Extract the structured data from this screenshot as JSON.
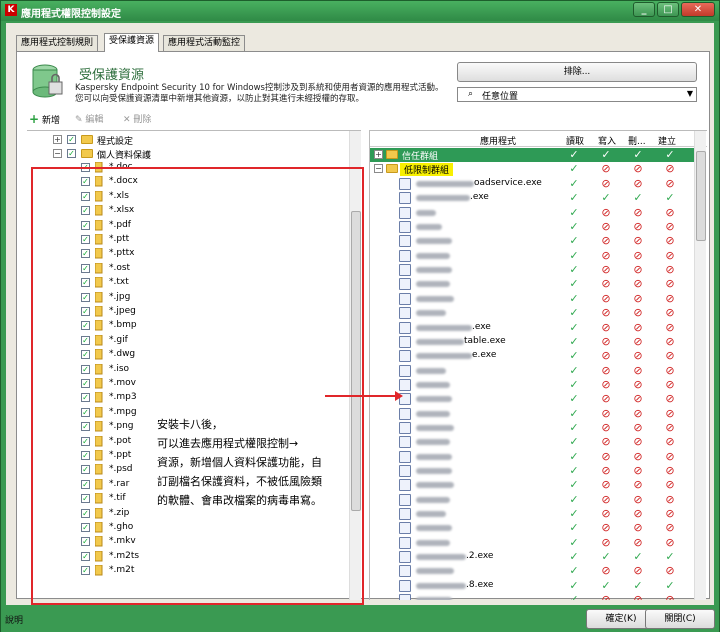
{
  "window": {
    "title": "應用程式權限控制設定",
    "min": "_",
    "max": "□",
    "close": "✕"
  },
  "tabs": [
    "應用程式控制規則",
    "受保護資源",
    "應用程式活動監控"
  ],
  "header": {
    "title": "受保護資源",
    "description": "Kaspersky Endpoint Security 10 for Windows控制涉及到系統和使用者資源的應用程式活動。您可以向受保護資源清單中新增其他資源，以防止對其進行未經授權的存取。",
    "exclude_label": "排除...",
    "location_label": "任意位置"
  },
  "toolbar": {
    "add": "新增",
    "edit": "編輯",
    "delete": "刪除"
  },
  "tree": {
    "app_settings": "程式設定",
    "personal_data": "個人資料保護",
    "extensions": [
      "*.doc",
      "*.docx",
      "*.xls",
      "*.xlsx",
      "*.pdf",
      "*.ptt",
      "*.pttx",
      "*.ost",
      "*.txt",
      "*.jpg",
      "*.jpeg",
      "*.bmp",
      "*.gif",
      "*.dwg",
      "*.iso",
      "*.mov",
      "*.mp3",
      "*.mpg",
      "*.png",
      "*.pot",
      "*.ppt",
      "*.psd",
      "*.rar",
      "*.tif",
      "*.zip",
      "*.gho",
      "*.mkv",
      "*.m2ts",
      "*.m2t"
    ]
  },
  "callout": [
    "安裝卡八後，",
    "可以進去應用程式權限控制→",
    "資源，新增個人資料保護功能，自",
    "訂副檔名保護資料，不被低風險類",
    "的軟體、會串改檔案的病毒串寫。"
  ],
  "right": {
    "columns": {
      "app": "應用程式",
      "read": "讀取",
      "write": "寫入",
      "delete": "刪...",
      "create": "建立"
    },
    "trusted_group": "信任群組",
    "low_group": "低限制群組",
    "apps": [
      {
        "name": "oadservice.exe",
        "blur": 58,
        "r": "ok",
        "w": "no",
        "d": "no",
        "c": "no"
      },
      {
        "name": ".exe",
        "blur": 54,
        "r": "ok",
        "w": "ok",
        "d": "ok",
        "c": "ok"
      },
      {
        "name": "",
        "blur": 20,
        "r": "ok",
        "w": "no",
        "d": "no",
        "c": "no"
      },
      {
        "name": "",
        "blur": 26,
        "r": "ok",
        "w": "no",
        "d": "no",
        "c": "no"
      },
      {
        "name": "",
        "blur": 36,
        "r": "ok",
        "w": "no",
        "d": "no",
        "c": "no"
      },
      {
        "name": "",
        "blur": 34,
        "r": "ok",
        "w": "no",
        "d": "no",
        "c": "no"
      },
      {
        "name": "",
        "blur": 36,
        "r": "ok",
        "w": "no",
        "d": "no",
        "c": "no"
      },
      {
        "name": "",
        "blur": 34,
        "r": "ok",
        "w": "no",
        "d": "no",
        "c": "no"
      },
      {
        "name": "",
        "blur": 38,
        "r": "ok",
        "w": "no",
        "d": "no",
        "c": "no"
      },
      {
        "name": "",
        "blur": 30,
        "r": "ok",
        "w": "no",
        "d": "no",
        "c": "no"
      },
      {
        "name": ".exe",
        "blur": 56,
        "r": "ok",
        "w": "no",
        "d": "no",
        "c": "no"
      },
      {
        "name": "table.exe",
        "blur": 48,
        "r": "ok",
        "w": "no",
        "d": "no",
        "c": "no"
      },
      {
        "name": "e.exe",
        "blur": 56,
        "r": "ok",
        "w": "no",
        "d": "no",
        "c": "no"
      },
      {
        "name": "",
        "blur": 30,
        "r": "ok",
        "w": "no",
        "d": "no",
        "c": "no"
      },
      {
        "name": "",
        "blur": 34,
        "r": "ok",
        "w": "no",
        "d": "no",
        "c": "no"
      },
      {
        "name": "",
        "blur": 36,
        "r": "ok",
        "w": "no",
        "d": "no",
        "c": "no"
      },
      {
        "name": "",
        "blur": 34,
        "r": "ok",
        "w": "no",
        "d": "no",
        "c": "no"
      },
      {
        "name": "",
        "blur": 38,
        "r": "ok",
        "w": "no",
        "d": "no",
        "c": "no"
      },
      {
        "name": "",
        "blur": 34,
        "r": "ok",
        "w": "no",
        "d": "no",
        "c": "no"
      },
      {
        "name": "",
        "blur": 36,
        "r": "ok",
        "w": "no",
        "d": "no",
        "c": "no"
      },
      {
        "name": "",
        "blur": 36,
        "r": "ok",
        "w": "no",
        "d": "no",
        "c": "no"
      },
      {
        "name": "",
        "blur": 38,
        "r": "ok",
        "w": "no",
        "d": "no",
        "c": "no"
      },
      {
        "name": "",
        "blur": 34,
        "r": "ok",
        "w": "no",
        "d": "no",
        "c": "no"
      },
      {
        "name": "",
        "blur": 30,
        "r": "ok",
        "w": "no",
        "d": "no",
        "c": "no"
      },
      {
        "name": "",
        "blur": 36,
        "r": "ok",
        "w": "no",
        "d": "no",
        "c": "no"
      },
      {
        "name": "",
        "blur": 34,
        "r": "ok",
        "w": "no",
        "d": "no",
        "c": "no"
      },
      {
        "name": ".2.exe",
        "blur": 50,
        "r": "ok",
        "w": "ok",
        "d": "ok",
        "c": "ok"
      },
      {
        "name": "",
        "blur": 38,
        "r": "ok",
        "w": "no",
        "d": "no",
        "c": "no"
      },
      {
        "name": ".8.exe",
        "blur": 50,
        "r": "ok",
        "w": "ok",
        "d": "ok",
        "c": "ok"
      },
      {
        "name": "",
        "blur": 36,
        "r": "ok",
        "w": "no",
        "d": "no",
        "c": "no"
      },
      {
        "name": "",
        "blur": 34,
        "r": "ok",
        "w": "no",
        "d": "no",
        "c": "no"
      },
      {
        "name": "",
        "blur": 38,
        "r": "ok",
        "w": "no",
        "d": "no",
        "c": "no"
      },
      {
        "name": "",
        "blur": 36,
        "r": "ok",
        "w": "no",
        "d": "no",
        "c": "no"
      }
    ]
  },
  "footer": {
    "help": "說明",
    "ok": "確定(K)",
    "close": "關閉(C)"
  }
}
